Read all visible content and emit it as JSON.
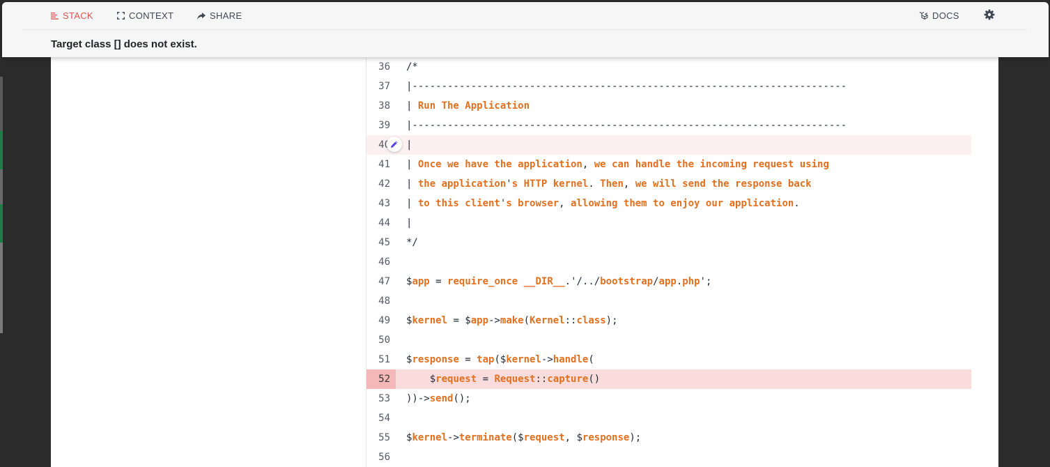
{
  "nav": {
    "stack_label": "STACK",
    "context_label": "CONTEXT",
    "share_label": "SHARE",
    "docs_label": "DOCS"
  },
  "exception": {
    "message": "Target class [] does not exist."
  },
  "colors": {
    "accent": "#e05350",
    "code_highlight": "#e2701f",
    "error_line": "#fbdcdc"
  },
  "code": {
    "lines": [
      {
        "number": "36",
        "tokens": [
          [
            "/*",
            false
          ]
        ]
      },
      {
        "number": "37",
        "tokens": [
          [
            "|--------------------------------------------------------------------------",
            false
          ]
        ]
      },
      {
        "number": "38",
        "tokens": [
          [
            "| ",
            false
          ],
          [
            "Run The Application",
            true
          ]
        ]
      },
      {
        "number": "39",
        "tokens": [
          [
            "|--------------------------------------------------------------------------",
            false
          ]
        ]
      },
      {
        "number": "40",
        "highlight": "light",
        "editor": true,
        "tokens": [
          [
            "|",
            false
          ]
        ]
      },
      {
        "number": "41",
        "tokens": [
          [
            "| ",
            false
          ],
          [
            "Once we have the application",
            true
          ],
          [
            ", ",
            false
          ],
          [
            "we can handle the incoming request using",
            true
          ]
        ]
      },
      {
        "number": "42",
        "tokens": [
          [
            "| ",
            false
          ],
          [
            "the application",
            true
          ],
          [
            "'",
            false
          ],
          [
            "s HTTP kernel",
            true
          ],
          [
            ". ",
            false
          ],
          [
            "Then",
            true
          ],
          [
            ", ",
            false
          ],
          [
            "we will send the response back",
            true
          ]
        ]
      },
      {
        "number": "43",
        "tokens": [
          [
            "| ",
            false
          ],
          [
            "to this client",
            true
          ],
          [
            "'",
            false
          ],
          [
            "s browser",
            true
          ],
          [
            ", ",
            false
          ],
          [
            "allowing them to enjoy our application",
            true
          ],
          [
            ".",
            false
          ]
        ]
      },
      {
        "number": "44",
        "tokens": [
          [
            "|",
            false
          ]
        ]
      },
      {
        "number": "45",
        "tokens": [
          [
            "*/",
            false
          ]
        ]
      },
      {
        "number": "46",
        "tokens": []
      },
      {
        "number": "47",
        "tokens": [
          [
            "$",
            false
          ],
          [
            "app",
            true
          ],
          [
            " = ",
            false
          ],
          [
            "require_once",
            true
          ],
          [
            " ",
            false
          ],
          [
            "__DIR__",
            true
          ],
          [
            ".'/../",
            false
          ],
          [
            "bootstrap",
            true
          ],
          [
            "/",
            false
          ],
          [
            "app",
            true
          ],
          [
            ".",
            false
          ],
          [
            "php",
            true
          ],
          [
            "';",
            false
          ]
        ]
      },
      {
        "number": "48",
        "tokens": []
      },
      {
        "number": "49",
        "tokens": [
          [
            "$",
            false
          ],
          [
            "kernel",
            true
          ],
          [
            " = $",
            false
          ],
          [
            "app",
            true
          ],
          [
            "->",
            false
          ],
          [
            "make",
            true
          ],
          [
            "(",
            false
          ],
          [
            "Kernel",
            true
          ],
          [
            "::",
            false
          ],
          [
            "class",
            true
          ],
          [
            ");",
            false
          ]
        ]
      },
      {
        "number": "50",
        "tokens": []
      },
      {
        "number": "51",
        "tokens": [
          [
            "$",
            false
          ],
          [
            "response",
            true
          ],
          [
            " = ",
            false
          ],
          [
            "tap",
            true
          ],
          [
            "($",
            false
          ],
          [
            "kernel",
            true
          ],
          [
            "->",
            false
          ],
          [
            "handle",
            true
          ],
          [
            "(",
            false
          ]
        ]
      },
      {
        "number": "52",
        "highlight": "strong",
        "tokens": [
          [
            "    $",
            false
          ],
          [
            "request",
            true
          ],
          [
            " = ",
            false
          ],
          [
            "Request",
            true
          ],
          [
            "::",
            false
          ],
          [
            "capture",
            true
          ],
          [
            "()",
            false
          ]
        ]
      },
      {
        "number": "53",
        "tokens": [
          [
            "))->",
            false
          ],
          [
            "send",
            true
          ],
          [
            "();",
            false
          ]
        ]
      },
      {
        "number": "54",
        "tokens": []
      },
      {
        "number": "55",
        "tokens": [
          [
            "$",
            false
          ],
          [
            "kernel",
            true
          ],
          [
            "->",
            false
          ],
          [
            "terminate",
            true
          ],
          [
            "($",
            false
          ],
          [
            "request",
            true
          ],
          [
            ", $",
            false
          ],
          [
            "response",
            true
          ],
          [
            ");",
            false
          ]
        ]
      },
      {
        "number": "56",
        "tokens": []
      }
    ]
  }
}
